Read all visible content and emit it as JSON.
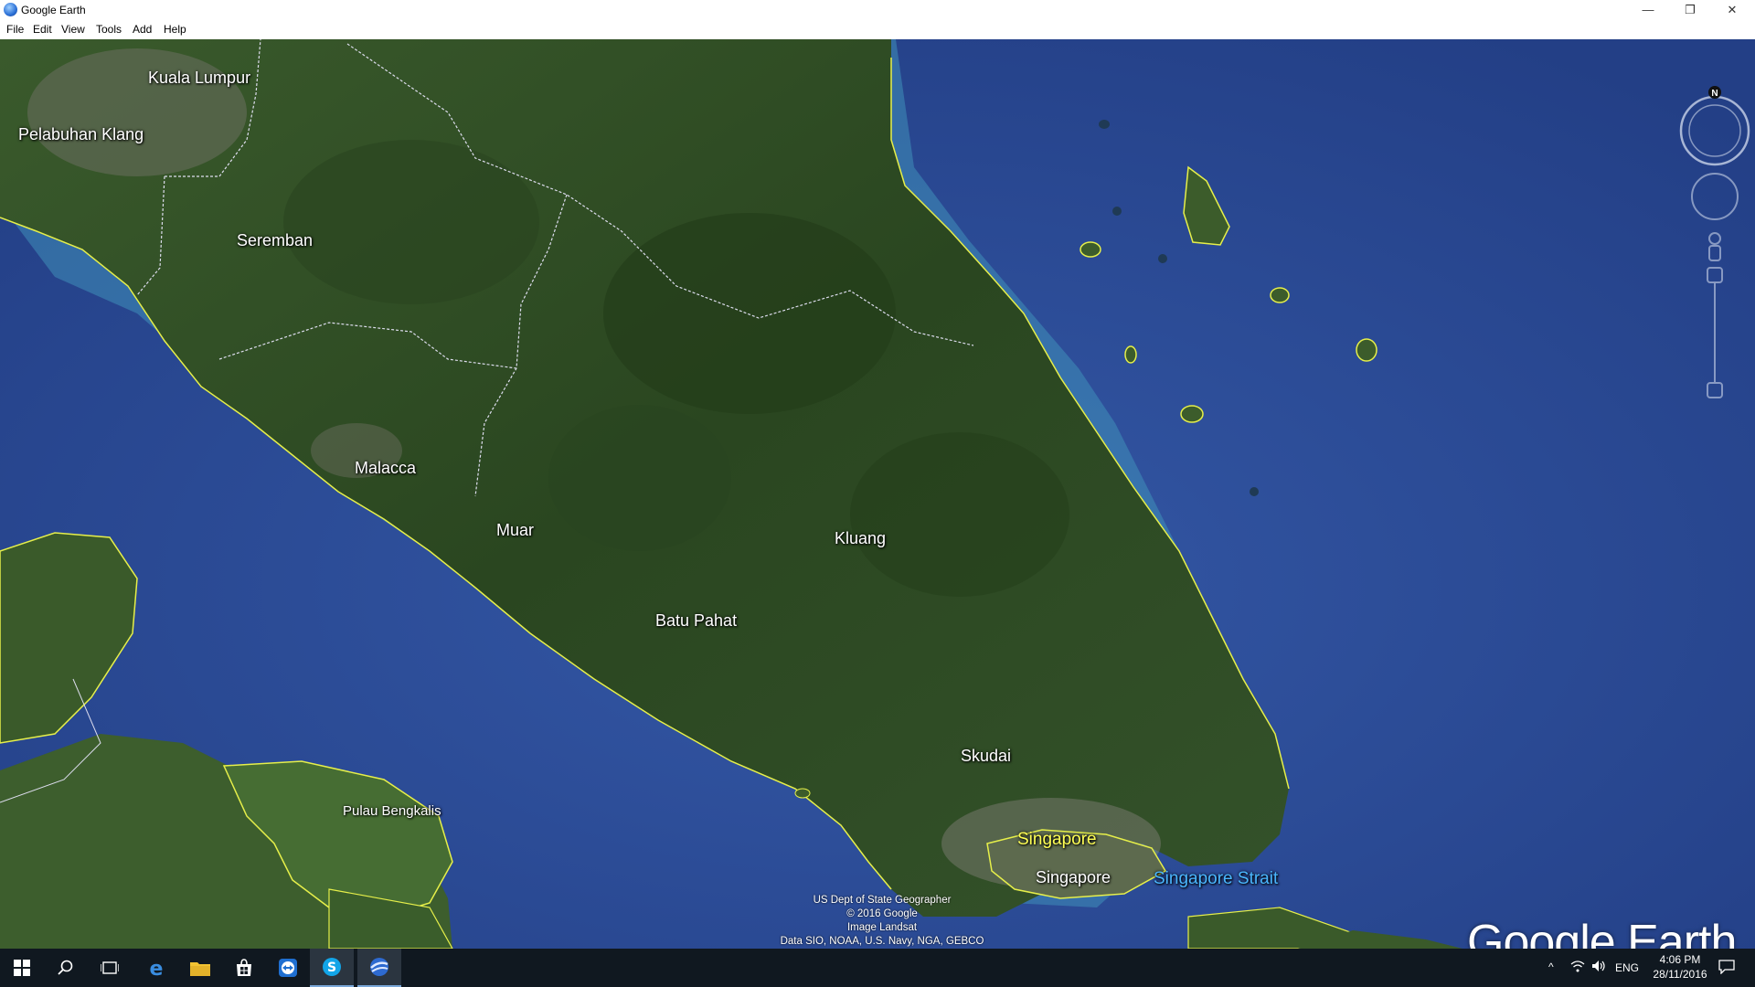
{
  "window": {
    "title": "Google Earth",
    "minimize_glyph": "—",
    "restore_glyph": "❐",
    "close_glyph": "✕"
  },
  "menu": {
    "file": "File",
    "edit": "Edit",
    "view": "View",
    "tools": "Tools",
    "add": "Add",
    "help": "Help"
  },
  "map": {
    "labels": {
      "kuala_lumpur": "Kuala Lumpur",
      "pelabuhan_klang": "Pelabuhan Klang",
      "seremban": "Seremban",
      "malacca": "Malacca",
      "muar": "Muar",
      "kluang": "Kluang",
      "batu_pahat": "Batu Pahat",
      "skudai": "Skudai",
      "singapore_country": "Singapore",
      "singapore_city": "Singapore",
      "singapore_strait": "Singapore Strait",
      "pulau_bengkalis": "Pulau Bengkalis"
    },
    "attribution": {
      "line1": "US Dept of State Geographer",
      "line2": "© 2016 Google",
      "line3": "Image Landsat",
      "line4": "Data SIO, NOAA, U.S. Navy, NGA, GEBCO"
    },
    "brand": "Google Earth",
    "compass_north": "N",
    "colors": {
      "sea": "#2a4f9a",
      "land": "#2d4a22",
      "border_yellow": "#e6ef4a",
      "shallow": "#3fa0c8"
    }
  },
  "taskbar": {
    "icons": [
      "windows-start-icon",
      "search-icon",
      "task-view-icon",
      "edge-icon",
      "file-explorer-icon",
      "store-icon",
      "teamviewer-icon",
      "skype-icon",
      "google-earth-icon"
    ],
    "language": "ENG",
    "time": "4:06 PM",
    "date": "28/11/2016"
  }
}
